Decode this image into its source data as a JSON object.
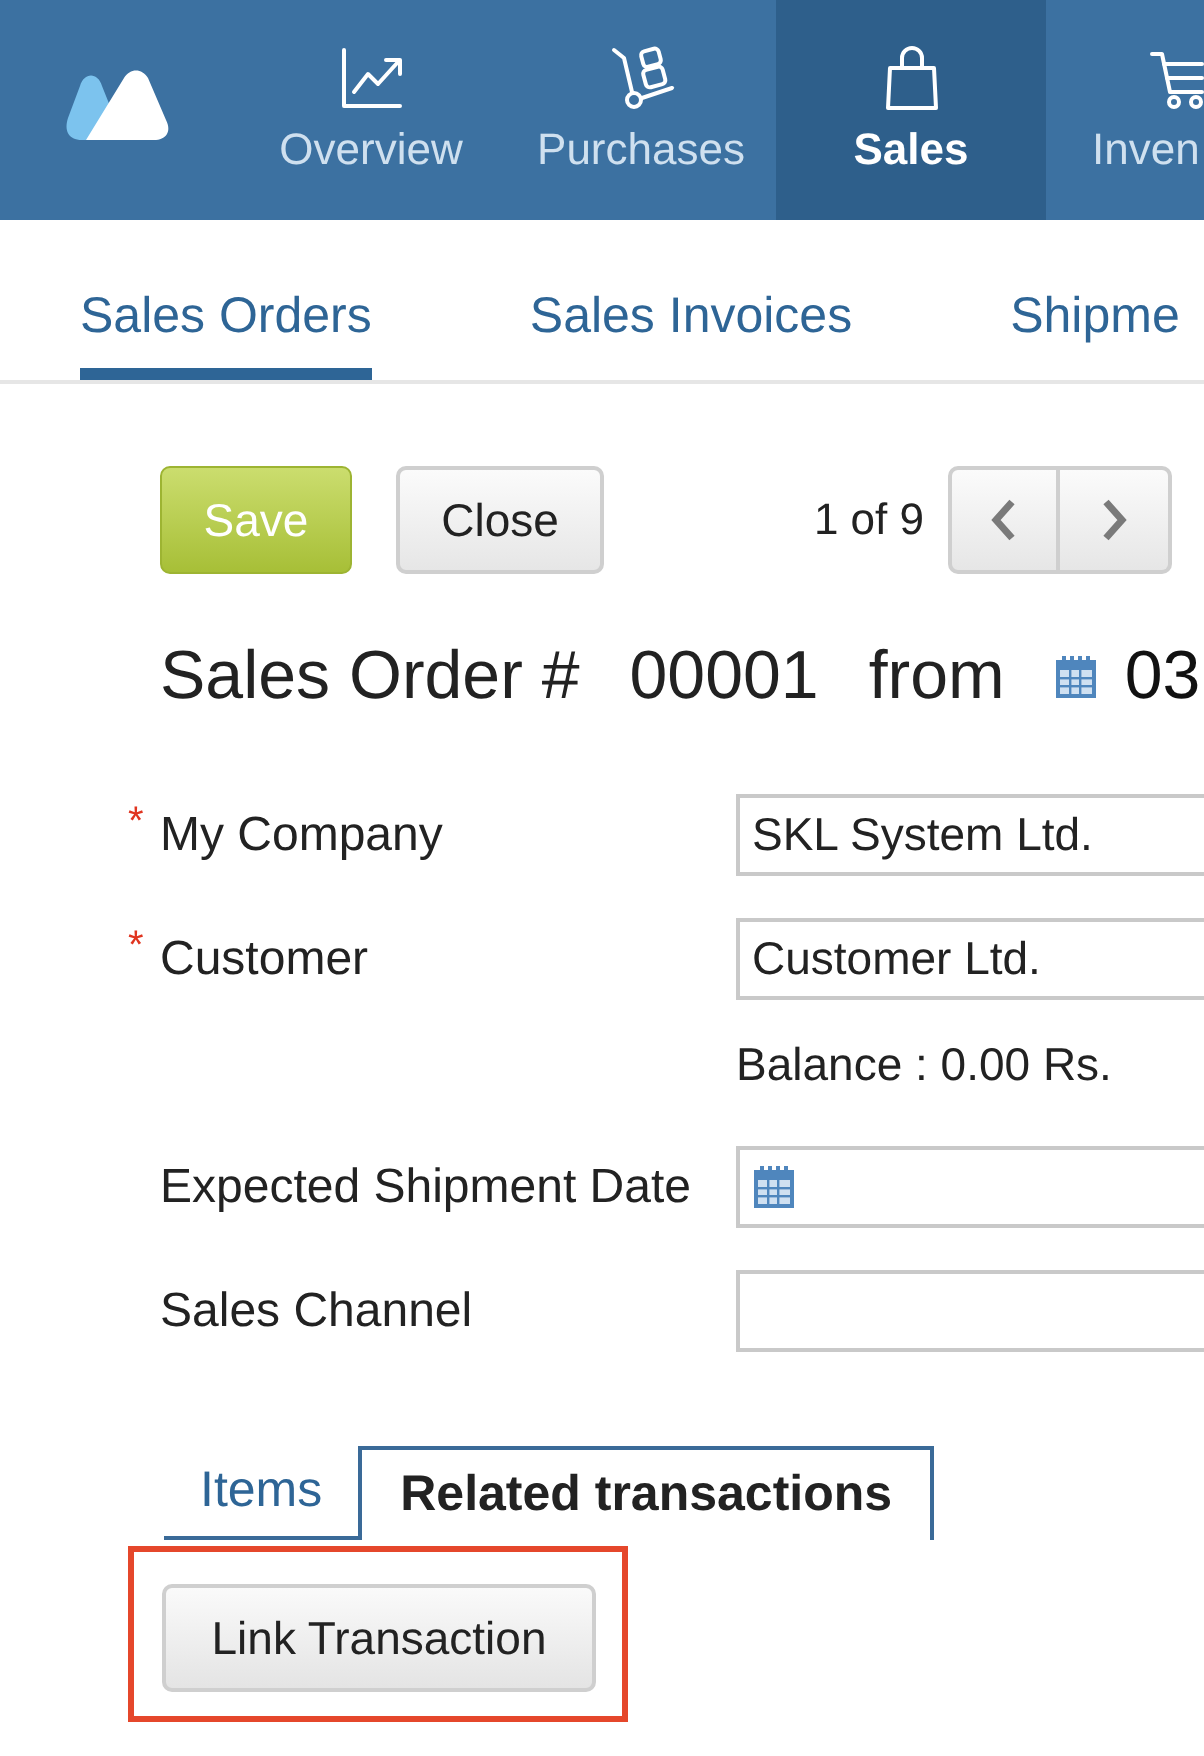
{
  "nav": {
    "items": [
      {
        "label": "Overview",
        "selected": false
      },
      {
        "label": "Purchases",
        "selected": false
      },
      {
        "label": "Sales",
        "selected": true
      },
      {
        "label": "Inven",
        "selected": false
      }
    ]
  },
  "subtabs": [
    {
      "label": "Sales Orders",
      "selected": true
    },
    {
      "label": "Sales Invoices",
      "selected": false
    },
    {
      "label": "Shipme",
      "selected": false
    }
  ],
  "toolbar": {
    "buttons": [
      {
        "label": "Save",
        "kind": "primary"
      },
      {
        "label": "Close",
        "kind": "default"
      }
    ],
    "pager": "1 of 9"
  },
  "heading": {
    "title": "Sales Order #",
    "number": "00001",
    "from": "from",
    "date": "03"
  },
  "fields": [
    {
      "label": "My Company",
      "required_mark": "*",
      "kind": "text",
      "value": "SKL System Ltd."
    },
    {
      "label": "Customer",
      "required_mark": "*",
      "kind": "text",
      "value": "Customer Ltd.",
      "note": "Balance : 0.00 Rs."
    },
    {
      "label": "Expected Shipment Date",
      "kind": "date"
    },
    {
      "label": "Sales Channel",
      "kind": "text"
    }
  ],
  "detail_tabs": [
    {
      "label": "Items",
      "selected": false
    },
    {
      "label": "Related transactions",
      "selected": true
    }
  ],
  "action": {
    "label": "Link Transaction",
    "highlighted": true
  }
}
